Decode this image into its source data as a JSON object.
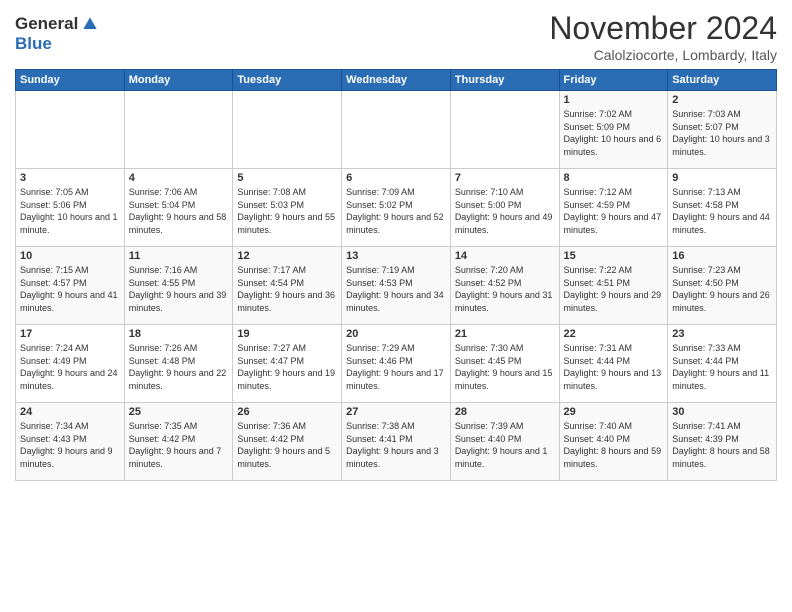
{
  "header": {
    "logo_line1": "General",
    "logo_line2": "Blue",
    "month_title": "November 2024",
    "location": "Calolziocorte, Lombardy, Italy"
  },
  "days_of_week": [
    "Sunday",
    "Monday",
    "Tuesday",
    "Wednesday",
    "Thursday",
    "Friday",
    "Saturday"
  ],
  "weeks": [
    [
      {
        "day": "",
        "info": ""
      },
      {
        "day": "",
        "info": ""
      },
      {
        "day": "",
        "info": ""
      },
      {
        "day": "",
        "info": ""
      },
      {
        "day": "",
        "info": ""
      },
      {
        "day": "1",
        "info": "Sunrise: 7:02 AM\nSunset: 5:09 PM\nDaylight: 10 hours and 6 minutes."
      },
      {
        "day": "2",
        "info": "Sunrise: 7:03 AM\nSunset: 5:07 PM\nDaylight: 10 hours and 3 minutes."
      }
    ],
    [
      {
        "day": "3",
        "info": "Sunrise: 7:05 AM\nSunset: 5:06 PM\nDaylight: 10 hours and 1 minute."
      },
      {
        "day": "4",
        "info": "Sunrise: 7:06 AM\nSunset: 5:04 PM\nDaylight: 9 hours and 58 minutes."
      },
      {
        "day": "5",
        "info": "Sunrise: 7:08 AM\nSunset: 5:03 PM\nDaylight: 9 hours and 55 minutes."
      },
      {
        "day": "6",
        "info": "Sunrise: 7:09 AM\nSunset: 5:02 PM\nDaylight: 9 hours and 52 minutes."
      },
      {
        "day": "7",
        "info": "Sunrise: 7:10 AM\nSunset: 5:00 PM\nDaylight: 9 hours and 49 minutes."
      },
      {
        "day": "8",
        "info": "Sunrise: 7:12 AM\nSunset: 4:59 PM\nDaylight: 9 hours and 47 minutes."
      },
      {
        "day": "9",
        "info": "Sunrise: 7:13 AM\nSunset: 4:58 PM\nDaylight: 9 hours and 44 minutes."
      }
    ],
    [
      {
        "day": "10",
        "info": "Sunrise: 7:15 AM\nSunset: 4:57 PM\nDaylight: 9 hours and 41 minutes."
      },
      {
        "day": "11",
        "info": "Sunrise: 7:16 AM\nSunset: 4:55 PM\nDaylight: 9 hours and 39 minutes."
      },
      {
        "day": "12",
        "info": "Sunrise: 7:17 AM\nSunset: 4:54 PM\nDaylight: 9 hours and 36 minutes."
      },
      {
        "day": "13",
        "info": "Sunrise: 7:19 AM\nSunset: 4:53 PM\nDaylight: 9 hours and 34 minutes."
      },
      {
        "day": "14",
        "info": "Sunrise: 7:20 AM\nSunset: 4:52 PM\nDaylight: 9 hours and 31 minutes."
      },
      {
        "day": "15",
        "info": "Sunrise: 7:22 AM\nSunset: 4:51 PM\nDaylight: 9 hours and 29 minutes."
      },
      {
        "day": "16",
        "info": "Sunrise: 7:23 AM\nSunset: 4:50 PM\nDaylight: 9 hours and 26 minutes."
      }
    ],
    [
      {
        "day": "17",
        "info": "Sunrise: 7:24 AM\nSunset: 4:49 PM\nDaylight: 9 hours and 24 minutes."
      },
      {
        "day": "18",
        "info": "Sunrise: 7:26 AM\nSunset: 4:48 PM\nDaylight: 9 hours and 22 minutes."
      },
      {
        "day": "19",
        "info": "Sunrise: 7:27 AM\nSunset: 4:47 PM\nDaylight: 9 hours and 19 minutes."
      },
      {
        "day": "20",
        "info": "Sunrise: 7:29 AM\nSunset: 4:46 PM\nDaylight: 9 hours and 17 minutes."
      },
      {
        "day": "21",
        "info": "Sunrise: 7:30 AM\nSunset: 4:45 PM\nDaylight: 9 hours and 15 minutes."
      },
      {
        "day": "22",
        "info": "Sunrise: 7:31 AM\nSunset: 4:44 PM\nDaylight: 9 hours and 13 minutes."
      },
      {
        "day": "23",
        "info": "Sunrise: 7:33 AM\nSunset: 4:44 PM\nDaylight: 9 hours and 11 minutes."
      }
    ],
    [
      {
        "day": "24",
        "info": "Sunrise: 7:34 AM\nSunset: 4:43 PM\nDaylight: 9 hours and 9 minutes."
      },
      {
        "day": "25",
        "info": "Sunrise: 7:35 AM\nSunset: 4:42 PM\nDaylight: 9 hours and 7 minutes."
      },
      {
        "day": "26",
        "info": "Sunrise: 7:36 AM\nSunset: 4:42 PM\nDaylight: 9 hours and 5 minutes."
      },
      {
        "day": "27",
        "info": "Sunrise: 7:38 AM\nSunset: 4:41 PM\nDaylight: 9 hours and 3 minutes."
      },
      {
        "day": "28",
        "info": "Sunrise: 7:39 AM\nSunset: 4:40 PM\nDaylight: 9 hours and 1 minute."
      },
      {
        "day": "29",
        "info": "Sunrise: 7:40 AM\nSunset: 4:40 PM\nDaylight: 8 hours and 59 minutes."
      },
      {
        "day": "30",
        "info": "Sunrise: 7:41 AM\nSunset: 4:39 PM\nDaylight: 8 hours and 58 minutes."
      }
    ]
  ]
}
